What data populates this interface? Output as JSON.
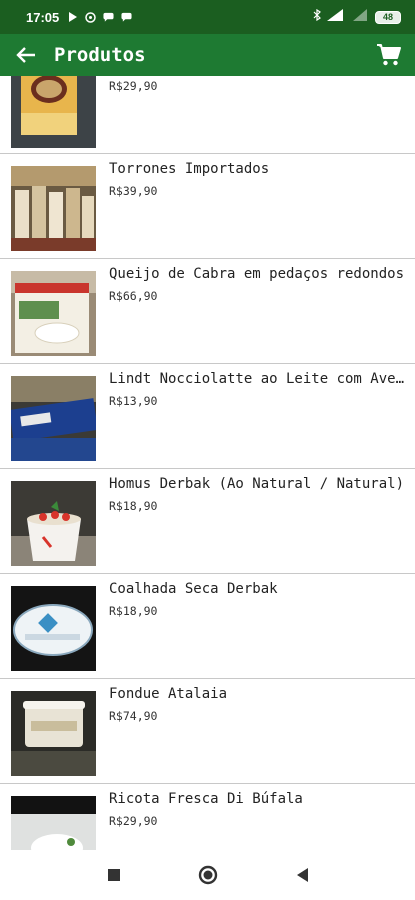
{
  "status_bar": {
    "time": "17:05",
    "battery": "48"
  },
  "app_bar": {
    "title": "Produtos",
    "color": "#1e7a32"
  },
  "products": [
    {
      "name": "",
      "price": "R$29,90"
    },
    {
      "name": "Torrones Importados",
      "price": "R$39,90"
    },
    {
      "name": "Queijo de Cabra em pedaços redondos",
      "price": "R$66,90"
    },
    {
      "name": "Lindt Nocciolatte ao Leite com Avelãs",
      "price": "R$13,90"
    },
    {
      "name": "Homus Derbak (Ao Natural / Natural)",
      "price": "R$18,90"
    },
    {
      "name": "Coalhada Seca Derbak",
      "price": "R$18,90"
    },
    {
      "name": "Fondue Atalaia",
      "price": "R$74,90"
    },
    {
      "name": "Ricota Fresca Di Búfala",
      "price": "R$29,90"
    }
  ],
  "icons": {
    "back": "arrow-back-icon",
    "cart": "cart-icon",
    "nav_recents": "square-icon",
    "nav_home": "circle-icon",
    "nav_back": "triangle-back-icon"
  }
}
